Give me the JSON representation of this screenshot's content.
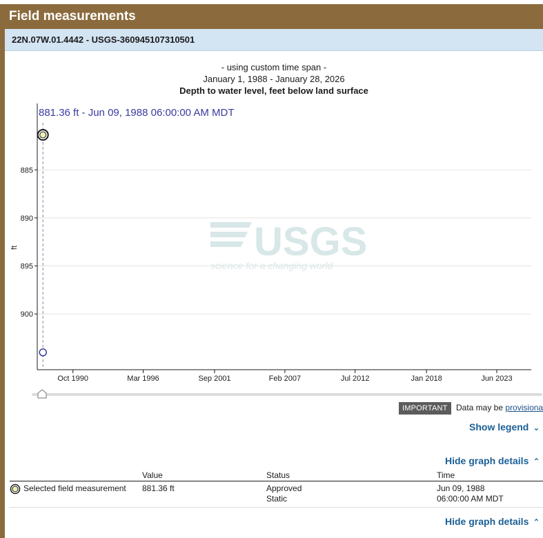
{
  "header": {
    "title": "Field measurements"
  },
  "site": {
    "id": "22N.07W.01.4442 - USGS-360945107310501"
  },
  "chart_header": {
    "line1": "- using custom time span -",
    "line2": "January 1, 1988 - January 28, 2026",
    "title": "Depth to water level, feet below land surface"
  },
  "hover_label": "881.36 ft - Jun 09, 1988 06:00:00 AM MDT",
  "watermark": {
    "logo": "USGS",
    "tagline": "science for a changing world"
  },
  "chart_data": {
    "type": "scatter",
    "title": "Depth to water level, feet below land surface",
    "ylabel": "ft",
    "xlabel": "",
    "y_inverted": true,
    "x_range": [
      "1988-01-01",
      "2026-01-28"
    ],
    "ylim": [
      880.1,
      905.8
    ],
    "y_ticks": [
      885,
      890,
      895,
      900
    ],
    "x_ticks": [
      {
        "date": "1990-10-01",
        "label": "Oct 1990"
      },
      {
        "date": "1996-03-01",
        "label": "Mar 1996"
      },
      {
        "date": "2001-09-01",
        "label": "Sep 2001"
      },
      {
        "date": "2007-02-01",
        "label": "Feb 2007"
      },
      {
        "date": "2012-07-01",
        "label": "Jul 2012"
      },
      {
        "date": "2018-01-01",
        "label": "Jan 2018"
      },
      {
        "date": "2023-06-01",
        "label": "Jun 2023"
      }
    ],
    "grid": true,
    "points": [
      {
        "date": "1988-06-09",
        "value": 881.36,
        "selected": true
      },
      {
        "date": "1988-06-09",
        "value": 904.0,
        "selected": false
      }
    ],
    "cursor_date": "1988-06-09"
  },
  "notice": {
    "badge": "IMPORTANT",
    "text": "Data may be",
    "link": "provisional"
  },
  "legend_toggle": "Show legend",
  "details_toggle": "Hide graph details",
  "details_toggle_bottom": "Hide graph details",
  "details_table": {
    "headers": [
      "",
      "Value",
      "Status",
      "Time"
    ],
    "row": {
      "label": "Selected field measurement",
      "value": "881.36 ft",
      "status1": "Approved",
      "status2": "Static",
      "time1": "Jun 09, 1988",
      "time2": "06:00:00 AM MDT"
    }
  },
  "colors": {
    "header": "#8b6b3d",
    "site_bar": "#d3e4f3",
    "selected_marker": "#f0f0b0",
    "point_marker": "#3a3a9e",
    "link": "#1a5f96"
  },
  "icons": {
    "legend_chevron": "chevron-down-icon",
    "details_chevron": "chevron-up-icon"
  }
}
